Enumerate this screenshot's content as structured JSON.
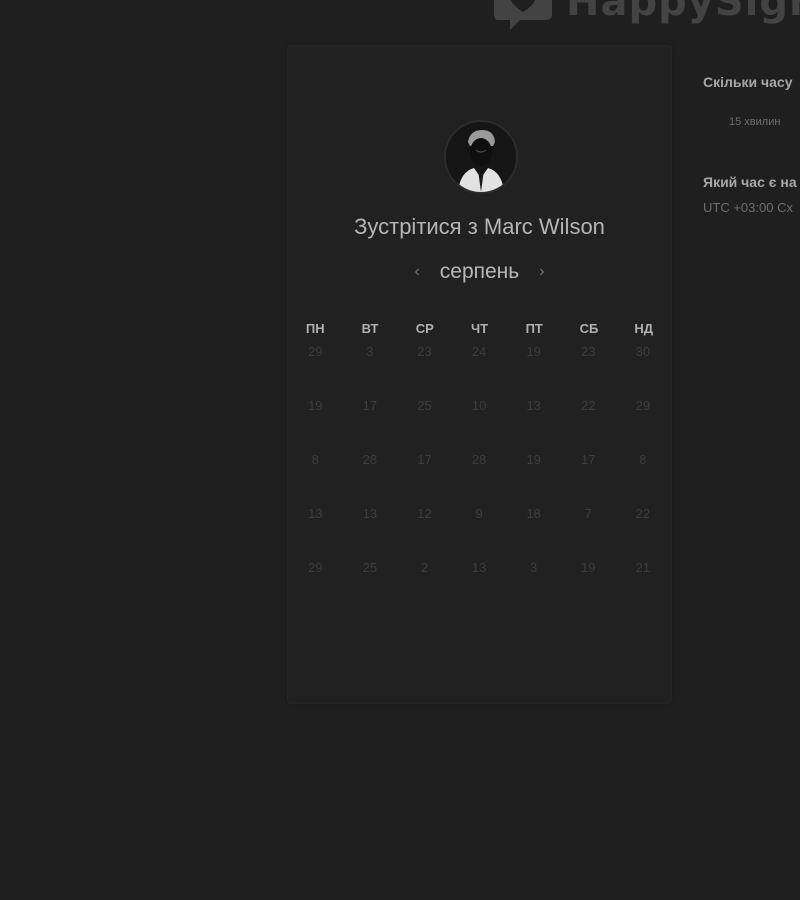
{
  "logo": {
    "text": "HappySign"
  },
  "card": {
    "title": "Зустрітися з Marc Wilson",
    "month": "серпень",
    "prev_arrow": "‹",
    "next_arrow": "›",
    "weekdays": [
      "ПН",
      "ВТ",
      "СР",
      "ЧТ",
      "ПТ",
      "СБ",
      "НД"
    ],
    "weeks": [
      [
        "29",
        "3",
        "23",
        "24",
        "19",
        "23",
        "30"
      ],
      [
        "19",
        "17",
        "25",
        "10",
        "13",
        "22",
        "29"
      ],
      [
        "8",
        "28",
        "17",
        "28",
        "19",
        "17",
        "8"
      ],
      [
        "13",
        "13",
        "12",
        "9",
        "18",
        "7",
        "22"
      ],
      [
        "29",
        "25",
        "2",
        "13",
        "3",
        "19",
        "21"
      ]
    ]
  },
  "info": {
    "duration_question": "Скільки часу",
    "duration_option": "15 хвилин",
    "timezone_question": "Який час є на",
    "timezone_value": "UTC +03:00 Сх"
  }
}
